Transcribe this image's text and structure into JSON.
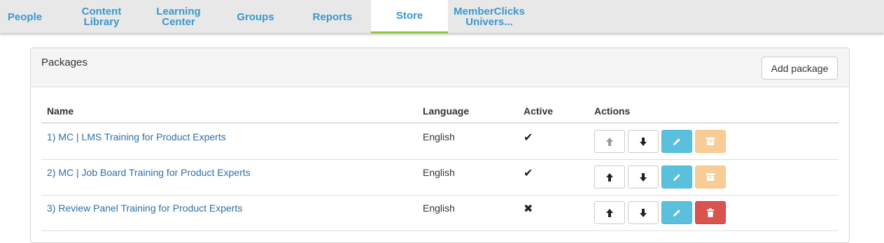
{
  "nav": {
    "tabs": [
      {
        "label": "People"
      },
      {
        "label": "Content Library"
      },
      {
        "label": "Learning Center"
      },
      {
        "label": "Groups"
      },
      {
        "label": "Reports"
      },
      {
        "label": "Store",
        "active": true
      },
      {
        "label": "MemberClicks Univers..."
      }
    ]
  },
  "panel": {
    "title": "Packages",
    "add_button": "Add package"
  },
  "table": {
    "headers": {
      "name": "Name",
      "language": "Language",
      "active": "Active",
      "actions": "Actions"
    },
    "rows": [
      {
        "name": "1) MC | LMS Training for Product Experts",
        "language": "English",
        "active": "✔",
        "up_disabled": true,
        "delete_enabled": false
      },
      {
        "name": "2) MC | Job Board Training for Product Experts",
        "language": "English",
        "active": "✔",
        "up_disabled": false,
        "delete_enabled": false
      },
      {
        "name": "3) Review Panel Training for Product Experts",
        "language": "English",
        "active": "✖",
        "up_disabled": false,
        "delete_enabled": true
      }
    ]
  },
  "icons": {
    "arrow_up": "arrow-up-icon",
    "arrow_down": "arrow-down-icon",
    "edit": "pencil-icon",
    "archive": "archive-icon",
    "delete": "trash-icon"
  },
  "colors": {
    "link": "#2f6fa7",
    "tab_text": "#3a98cc",
    "tab_active_underline": "#8cc63f",
    "info": "#5bc0de",
    "warning": "#f8cd95",
    "danger": "#d9534f"
  }
}
